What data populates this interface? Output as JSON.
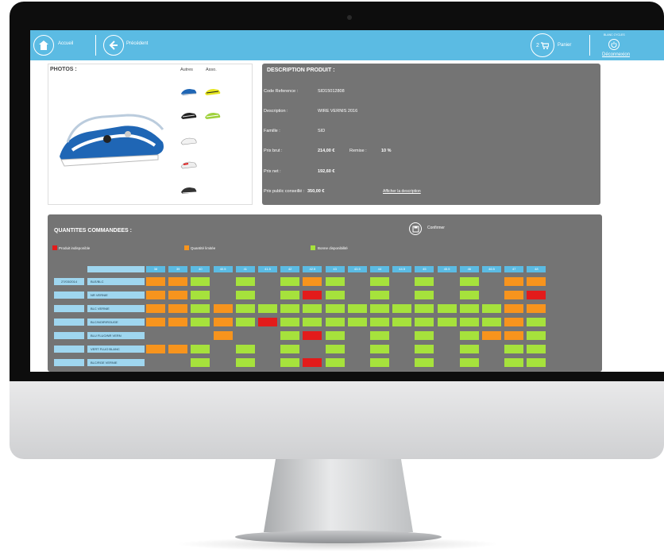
{
  "topbar": {
    "home_label": "Accueil",
    "back_label": "Précédent",
    "cart_count": "2",
    "cart_label": "Panier",
    "user_label": "BLANC CYCLES",
    "logout_label": "Déconnexion"
  },
  "photos": {
    "title": "PHOTOS :",
    "col_autres": "Autres",
    "col_asso": "Asso."
  },
  "description": {
    "title": "DESCRIPTION PRODUIT :",
    "ref_label": "Code Reference :",
    "ref_value": "SID15012808",
    "desc_label": "Description :",
    "desc_value": "WIRE VERNIS 2016",
    "family_label": "Famille :",
    "family_value": "SID",
    "prix_brut_label": "Prix brut :",
    "prix_brut_value": "214,00 €",
    "remise_label": "Remise :",
    "remise_value": "10 %",
    "prix_net_label": "Prix net :",
    "prix_net_value": "192,60 €",
    "prix_public_label": "Prix public conseillé :",
    "prix_public_value": "350,00 €",
    "link_label": "Afficher la description"
  },
  "quantities": {
    "title": "QUANTITES COMMANDEES :",
    "confirm_label": "Confirmer",
    "legend": [
      {
        "label": "Produit indisponible",
        "color": "#e31b1b"
      },
      {
        "label": "Quantité limitée",
        "color": "#f7941d"
      },
      {
        "label": "Bonne disponibilité",
        "color": "#a6e23c"
      }
    ],
    "date": "27/03/2014",
    "sizes": [
      "38",
      "39",
      "40",
      "40.5",
      "41",
      "41.5",
      "42",
      "42.5",
      "43",
      "43.5",
      "44",
      "44.5",
      "45",
      "45.5",
      "46",
      "46.5",
      "47",
      "48"
    ],
    "rows": [
      {
        "name": "BLE/BLC",
        "cells": [
          "o",
          "o",
          "g",
          "",
          "g",
          "",
          "g",
          "o",
          "g",
          "",
          "g",
          "",
          "g",
          "",
          "g",
          "",
          "o",
          "o"
        ]
      },
      {
        "name": "NR VERNIE",
        "cells": [
          "o",
          "o",
          "g",
          "",
          "g",
          "",
          "g",
          "r",
          "g",
          "",
          "g",
          "",
          "g",
          "",
          "g",
          "",
          "o",
          "r"
        ]
      },
      {
        "name": "BLC VERNIE",
        "cells": [
          "o",
          "o",
          "g",
          "o",
          "g",
          "g",
          "g",
          "g",
          "g",
          "g",
          "g",
          "g",
          "g",
          "g",
          "g",
          "g",
          "o",
          "o"
        ]
      },
      {
        "name": "BLC/NOIR/ROUGE",
        "cells": [
          "o",
          "o",
          "g",
          "o",
          "g",
          "r",
          "g",
          "g",
          "g",
          "g",
          "g",
          "g",
          "g",
          "g",
          "g",
          "g",
          "o",
          "g"
        ]
      },
      {
        "name": "BLU FLUO/NR VERN",
        "cells": [
          "",
          "",
          "",
          "o",
          "",
          "",
          "g",
          "r",
          "g",
          "",
          "g",
          "",
          "g",
          "",
          "g",
          "o",
          "o",
          "g"
        ]
      },
      {
        "name": "VERT FLUO BLANC",
        "cells": [
          "o",
          "o",
          "g",
          "",
          "g",
          "",
          "g",
          "",
          "g",
          "",
          "g",
          "",
          "g",
          "",
          "g",
          "",
          "g",
          "g"
        ]
      },
      {
        "name": "BLC/RGE VERNIE",
        "cells": [
          "",
          "",
          "g",
          "",
          "g",
          "",
          "g",
          "r",
          "g",
          "",
          "g",
          "",
          "g",
          "",
          "g",
          "",
          "g",
          "g"
        ]
      }
    ]
  },
  "colors": {
    "accent": "#5bbbe3",
    "panel": "#747474",
    "available": "#a6e23c",
    "limited": "#f7941d",
    "unavailable": "#e31b1b"
  }
}
